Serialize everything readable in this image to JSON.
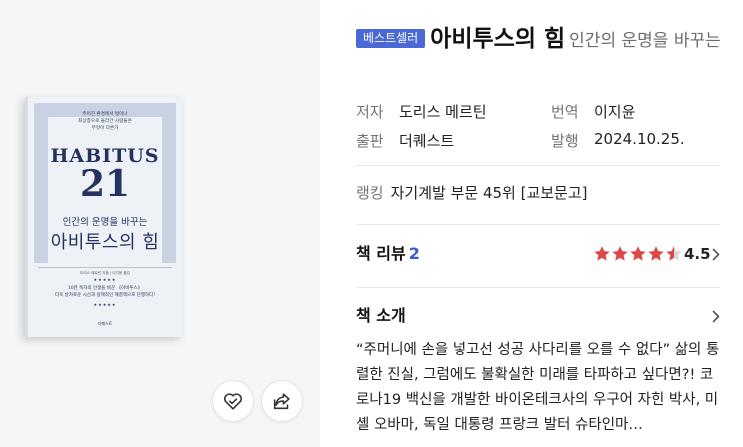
{
  "book": {
    "badge": "베스트셀러",
    "title": "아비투스의 힘",
    "subtitle": "인간의 운명을 바꾸는"
  },
  "cover": {
    "subtext": "주어진 환경에서 벗어나\n최상층으로 올라간 사람들은\n무엇이 다른가",
    "word": "HABITUS",
    "number": "21",
    "tagline": "인간의 운명을 바꾸는",
    "title": "아비투스의 힘",
    "authors": "도리스 메르틴 지음 | 이지윤 옮김",
    "stars": "★★★★★",
    "blurb": "10만 독자의 인생을 바꾼 《아비투스》\n더욱 날카로운 시선과 실제적인 해결책으로 단행하다!",
    "publisher": "더퀘스트"
  },
  "meta": {
    "author_label": "저자",
    "author": "도리스 메르틴",
    "translator_label": "번역",
    "translator": "이지윤",
    "publisher_label": "출판",
    "publisher": "더퀘스트",
    "date_label": "발행",
    "date": "2024.10.25."
  },
  "ranking": {
    "label": "랭킹",
    "value": "자기계발 부문 45위 [교보문고]"
  },
  "review": {
    "title": "책 리뷰",
    "count": "2",
    "rating": "4.5",
    "rating_value": 4.5,
    "star_color": "#e04747"
  },
  "intro": {
    "title": "책 소개",
    "text": "“주머니에 손을 넣고선 성공 사다리를 오를 수 없다” 삶의 통렬한 진실, 그럼에도 불확실한 미래를 타파하고 싶다면?!  코로나19 백신을 개발한 바이온테크사의 우구어 자힌 박사, 미셸 오바마, 독일 대통령 프랑크 발터 슈타인마…"
  },
  "icons": {
    "wish": "heart-check-icon",
    "share": "share-icon",
    "chevron": "chevron-right-icon"
  },
  "colors": {
    "badge": "#4a68d6",
    "accent": "#3c5bd1",
    "star": "#e04747"
  }
}
